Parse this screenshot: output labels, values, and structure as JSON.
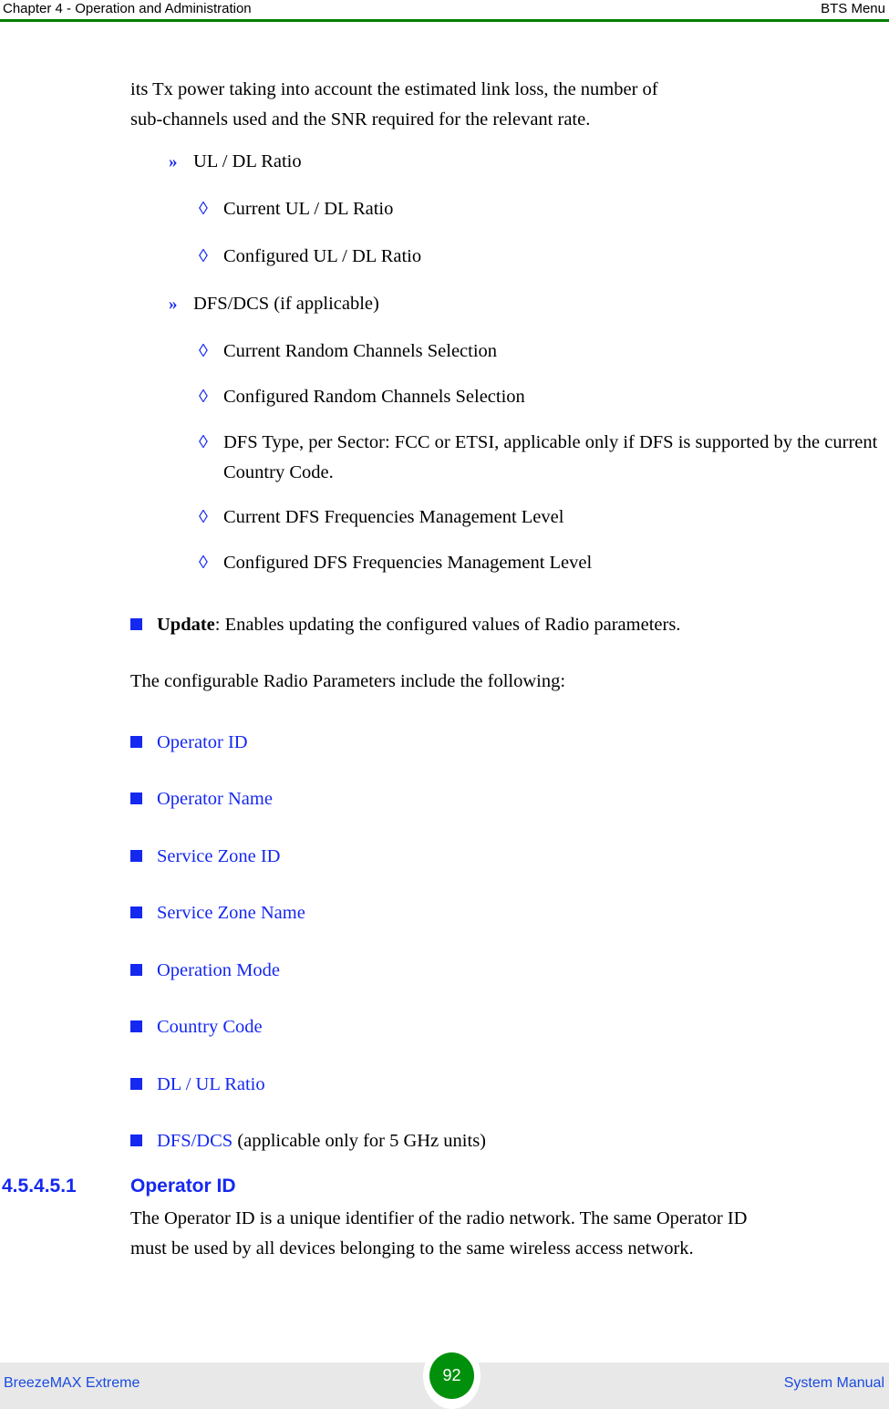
{
  "header": {
    "left": "Chapter 4 - Operation and Administration",
    "right": "BTS Menu",
    "rule_color": "#008000"
  },
  "content": {
    "intro_paragraph": {
      "line1": "its Tx power taking into account the estimated link loss, the number of",
      "line2": "sub-channels used and the SNR required for the relevant rate."
    },
    "groups": [
      {
        "label": "UL / DL Ratio",
        "marker": "chevron-double-right-icon",
        "children": [
          "Current UL / DL Ratio",
          "Configured UL / DL Ratio"
        ]
      },
      {
        "label": "DFS/DCS (if applicable)",
        "marker": "chevron-double-right-icon",
        "children": [
          "Current Random Channels Selection",
          "Configured Random Channels Selection",
          "DFS Type, per Sector: FCC or ETSI, applicable only if DFS is supported by the current Country Code.",
          "Current DFS Frequencies Management Level",
          "Configured DFS Frequencies Management Level"
        ]
      }
    ],
    "update_item": {
      "term": "Update",
      "description": ": Enables updating the configured values of Radio parameters."
    },
    "configurable_intro": "The configurable Radio Parameters include the following:",
    "configurable_params": [
      {
        "link": "Operator ID",
        "suffix": ""
      },
      {
        "link": "Operator Name",
        "suffix": ""
      },
      {
        "link": "Service Zone ID",
        "suffix": ""
      },
      {
        "link": "Service Zone Name",
        "suffix": ""
      },
      {
        "link": "Operation Mode",
        "suffix": ""
      },
      {
        "link": "Country Code",
        "suffix": ""
      },
      {
        "link": "DL / UL Ratio",
        "suffix": ""
      },
      {
        "link": "DFS/DCS",
        "suffix": " (applicable only for 5 GHz units)"
      }
    ],
    "section": {
      "number": "4.5.4.5.1",
      "title": "Operator ID",
      "body_line1": "The Operator ID is a unique identifier of the radio network. The same Operator ID",
      "body_line2": "must be used by all devices belonging to the same wireless access network."
    }
  },
  "footer": {
    "left": "BreezeMAX Extreme",
    "right": "System Manual",
    "page_number": "92",
    "badge_color": "#00900b",
    "band_color": "#e8e8e8"
  },
  "glyphs": {
    "chevron": "»",
    "diamond": "◊"
  }
}
